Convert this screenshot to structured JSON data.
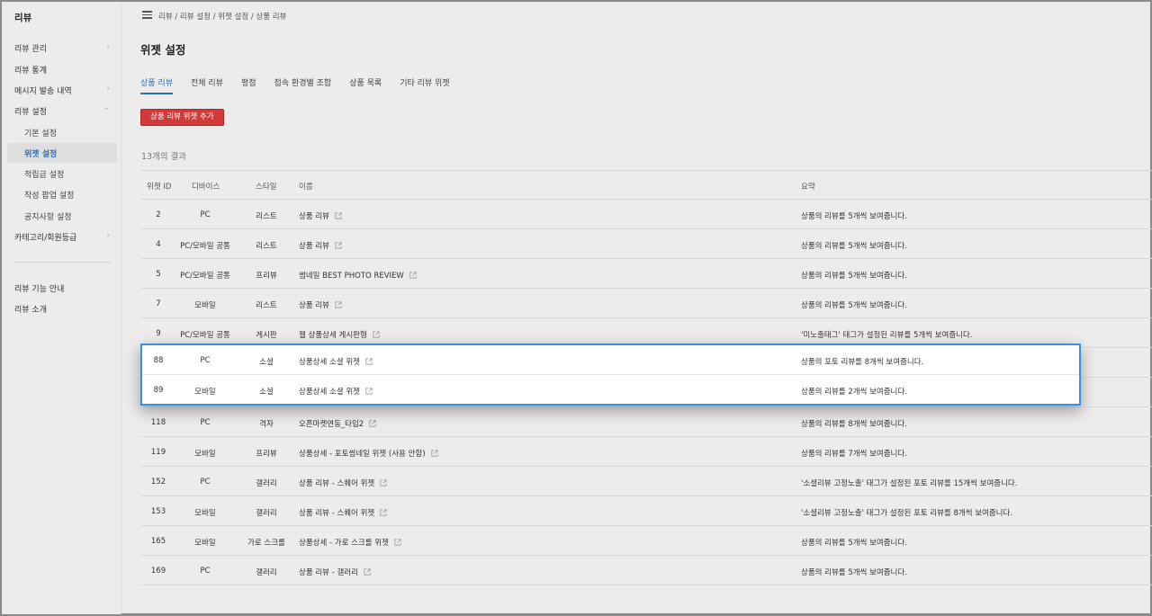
{
  "sidebar": {
    "brand": "리뷰",
    "items": [
      {
        "label": "리뷰 관리",
        "chevron": "›"
      },
      {
        "label": "리뷰 통계"
      },
      {
        "label": "메시지 발송 내역",
        "chevron": "›"
      },
      {
        "label": "리뷰 설정",
        "chevron": "⌄"
      }
    ],
    "sub_items": [
      {
        "label": "기본 설정"
      },
      {
        "label": "위젯 설정"
      },
      {
        "label": "적립금 설정"
      },
      {
        "label": "작성 팝업 설정"
      },
      {
        "label": "공지사항 설정"
      }
    ],
    "category": {
      "label": "카테고리/회원등급",
      "chevron": "›"
    },
    "bottom": [
      {
        "label": "리뷰 기능 안내"
      },
      {
        "label": "리뷰 소개"
      }
    ]
  },
  "header": {
    "breadcrumb": "리뷰 / 리뷰 설정 / 위젯 설정 / 상품 리뷰",
    "title": "위젯 설정"
  },
  "tabs": [
    "상품 리뷰",
    "전체 리뷰",
    "평점",
    "접속 환경별 조합",
    "상품 목록",
    "기타 리뷰 위젯"
  ],
  "add_button": "상품 리뷰 위젯 추가",
  "result_count": "13개의 결과",
  "table": {
    "headers": {
      "id": "위젯 ID",
      "device": "디바이스",
      "style": "스타일",
      "name": "이름",
      "summary": "요약"
    },
    "rows": [
      {
        "id": "2",
        "device": "PC",
        "style": "리스트",
        "name": "상품 리뷰",
        "summary": "상품의 리뷰를 5개씩 보여줍니다."
      },
      {
        "id": "4",
        "device": "PC/모바일 공통",
        "style": "리스트",
        "name": "상품 리뷰",
        "summary": "상품의 리뷰를 5개씩 보여줍니다."
      },
      {
        "id": "5",
        "device": "PC/모바일 공통",
        "style": "프리뷰",
        "name": "썸네일 BEST PHOTO REVIEW",
        "summary": "상품의 리뷰를 5개씩 보여줍니다."
      },
      {
        "id": "7",
        "device": "모바일",
        "style": "리스트",
        "name": "상품 리뷰",
        "summary": "상품의 리뷰를 5개씩 보여줍니다."
      },
      {
        "id": "9",
        "device": "PC/모바일 공통",
        "style": "게시판",
        "name": "웹 상품상세 게시판형",
        "summary": "'미노출태그' 태그가 설정된 리뷰를 5개씩 보여줍니다."
      },
      {
        "id": "88",
        "device": "PC",
        "style": "소셜",
        "name": "상품상세 소셜 위젯",
        "summary": "상품의 포토 리뷰를 8개씩 보여줍니다."
      },
      {
        "id": "89",
        "device": "모바일",
        "style": "소셜",
        "name": "상품상세 소셜 위젯",
        "summary": "상품의 리뷰를 2개씩 보여줍니다."
      },
      {
        "id": "118",
        "device": "PC",
        "style": "격자",
        "name": "오픈마켓연동_타입2",
        "summary": "상품의 리뷰를 8개씩 보여줍니다."
      },
      {
        "id": "119",
        "device": "모바일",
        "style": "프리뷰",
        "name": "상품상세 - 포토썸네일 위젯 (사용 안함)",
        "summary": "상품의 리뷰를 7개씩 보여줍니다."
      },
      {
        "id": "152",
        "device": "PC",
        "style": "갤러리",
        "name": "상품 리뷰 - 스퀘어 위젯",
        "summary": "'소셜리뷰 고정노출' 태그가 설정된 포토 리뷰를 15개씩 보여줍니다."
      },
      {
        "id": "153",
        "device": "모바일",
        "style": "갤러리",
        "name": "상품 리뷰 - 스퀘어 위젯",
        "summary": "'소셜리뷰 고정노출' 태그가 설정된 포토 리뷰를 8개씩 보여줍니다."
      },
      {
        "id": "165",
        "device": "모바일",
        "style": "가로 스크롤",
        "name": "상품상세 - 가로 스크롤 위젯",
        "summary": "상품의 리뷰를 5개씩 보여줍니다."
      },
      {
        "id": "169",
        "device": "PC",
        "style": "갤러리",
        "name": "상품 리뷰 - 갤러리",
        "summary": "상품의 리뷰를 5개씩 보여줍니다."
      }
    ]
  },
  "colors": {
    "accent": "#2f6db5",
    "danger": "#d23a3a",
    "highlight_border": "#3a8ee0"
  }
}
